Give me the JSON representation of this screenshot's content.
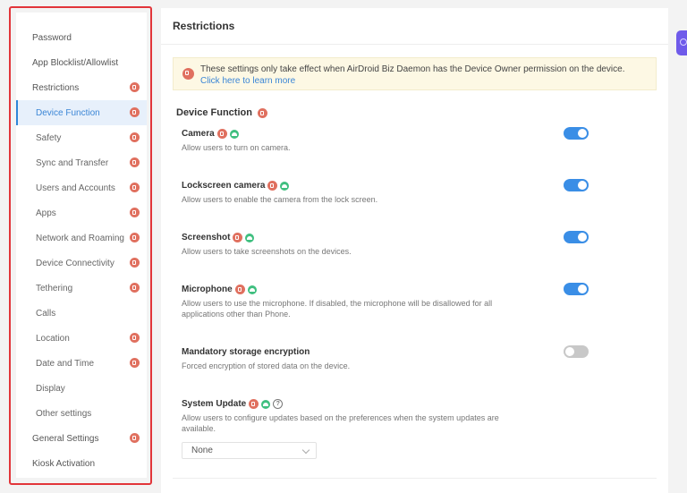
{
  "sidebar": {
    "items": [
      {
        "label": "Password",
        "level": "top",
        "locked": false,
        "active": false
      },
      {
        "label": "App Blocklist/Allowlist",
        "level": "top",
        "locked": false,
        "active": false
      },
      {
        "label": "Restrictions",
        "level": "top",
        "locked": true,
        "active": false
      },
      {
        "label": "Device Function",
        "level": "sub",
        "locked": true,
        "active": true
      },
      {
        "label": "Safety",
        "level": "sub",
        "locked": true,
        "active": false
      },
      {
        "label": "Sync and Transfer",
        "level": "sub",
        "locked": true,
        "active": false
      },
      {
        "label": "Users and Accounts",
        "level": "sub",
        "locked": true,
        "active": false
      },
      {
        "label": "Apps",
        "level": "sub",
        "locked": true,
        "active": false
      },
      {
        "label": "Network and Roaming",
        "level": "sub",
        "locked": true,
        "active": false
      },
      {
        "label": "Device Connectivity",
        "level": "sub",
        "locked": true,
        "active": false
      },
      {
        "label": "Tethering",
        "level": "sub",
        "locked": true,
        "active": false
      },
      {
        "label": "Calls",
        "level": "sub",
        "locked": false,
        "active": false
      },
      {
        "label": "Location",
        "level": "sub",
        "locked": true,
        "active": false
      },
      {
        "label": "Date and Time",
        "level": "sub",
        "locked": true,
        "active": false
      },
      {
        "label": "Display",
        "level": "sub",
        "locked": false,
        "active": false
      },
      {
        "label": "Other settings",
        "level": "sub",
        "locked": false,
        "active": false
      },
      {
        "label": "General Settings",
        "level": "top",
        "locked": true,
        "active": false
      },
      {
        "label": "Kiosk Activation",
        "level": "top",
        "locked": false,
        "active": false
      }
    ]
  },
  "main": {
    "title": "Restrictions",
    "notice": {
      "text": "These settings only take effect when AirDroid Biz Daemon has the Device Owner permission on the device.",
      "link": "Click here to learn more"
    },
    "section_title": "Device Function",
    "settings": [
      {
        "name": "Camera",
        "desc": "Allow users to turn on camera.",
        "enabled": true
      },
      {
        "name": "Lockscreen camera",
        "desc": "Allow users to enable the camera from the lock screen.",
        "enabled": true
      },
      {
        "name": "Screenshot",
        "desc": "Allow users to take screenshots on the devices.",
        "enabled": true
      },
      {
        "name": "Microphone",
        "desc": "Allow users to use the microphone. If disabled, the microphone will be disallowed for all applications other than Phone.",
        "enabled": true
      },
      {
        "name": "Mandatory storage encryption",
        "desc": "Forced encryption of stored data on the device.",
        "enabled": false
      },
      {
        "name": "System Update",
        "desc": "Allow users to configure updates based on the preferences when the system updates are available."
      }
    ],
    "system_update_select": {
      "value": "None"
    },
    "help_glyph": "?"
  },
  "colors": {
    "accent": "#3a8ee6",
    "lock_badge": "#e0705f",
    "android_badge": "#3fbf7f",
    "highlight_frame": "#e2353a",
    "float_button": "#6f5bea"
  }
}
